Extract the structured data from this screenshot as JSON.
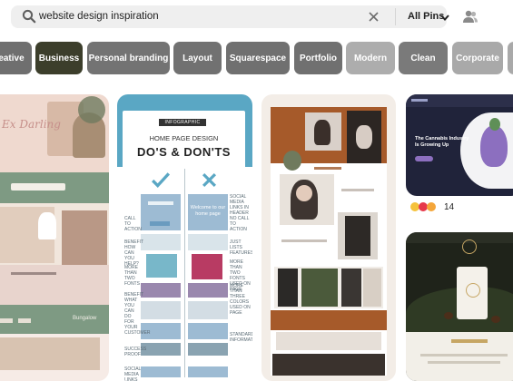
{
  "search": {
    "query": "website design inspiration",
    "filter_label": "All Pins"
  },
  "chips": [
    {
      "label": "eative",
      "color": "#6f6f6f"
    },
    {
      "label": "Business",
      "color": "#3c3e2b"
    },
    {
      "label": "Personal branding",
      "color": "#737373"
    },
    {
      "label": "Layout",
      "color": "#717171"
    },
    {
      "label": "Squarespace",
      "color": "#707070"
    },
    {
      "label": "Portfolio",
      "color": "#707070"
    },
    {
      "label": "Modern",
      "color": "#adadad"
    },
    {
      "label": "Clean",
      "color": "#7a7a7a"
    },
    {
      "label": "Corporate",
      "color": "#a9a9a9"
    }
  ],
  "pins": {
    "infographic": {
      "tag": "INFOGRAPHIC",
      "title_line1": "HOME PAGE DESIGN",
      "title_line2": "DO'S & DON'TS",
      "welcome_text": "Welcome to our home page",
      "left_labels": [
        "CALL TO ACTION",
        "BENEFIT HOW CAN YOU HELP?",
        "MORE THAN TWO FONTS",
        "BENEFIT WHAT YOU CAN DO FOR YOUR CUSTOMER",
        "SUCCESS PROOF",
        "SOCIAL MEDIA LINKS"
      ],
      "right_labels": [
        "SOCIAL MEDIA LINKS IN HEADER",
        "NO CALL TO ACTION",
        "JUST LISTS FEATURES",
        "MORE THAN TWO FONTS USED ON PAGE",
        "MORE THAN THREE COLORS USED ON PAGE",
        "STANDARD INFORMATION"
      ]
    },
    "cannabis": {
      "heading": "The Cannabis Industry Is Growing Up",
      "reaction_count": "14"
    },
    "left_card": {
      "script_text": "Ex Darling",
      "footer_text": "Bungalow"
    }
  },
  "colors": {
    "accent_blue": "#5aa7c4",
    "rust": "#a65a2a",
    "sage": "#7e9a83"
  }
}
